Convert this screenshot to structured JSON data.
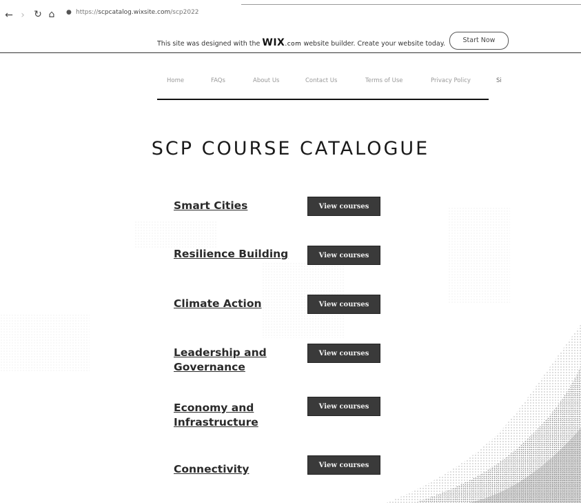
{
  "browser": {
    "url_prefix": "https://",
    "url_host": "scpcatalog.wixsite.com",
    "url_path": "/scp2022"
  },
  "wix_banner": {
    "text_before": "This site was designed with the ",
    "logo": "WIX",
    "logo_suffix": ".com",
    "text_after": " website builder. Create your website today.",
    "button": "Start Now"
  },
  "nav": {
    "items": [
      "Home",
      "FAQs",
      "About Us",
      "Contact Us",
      "Terms of Use",
      "Privacy Policy",
      "Si"
    ]
  },
  "page": {
    "title": "SCP COURSE CATALOGUE"
  },
  "courses": [
    {
      "name": "Smart Cities",
      "button": "View courses"
    },
    {
      "name": "Resilience Building",
      "button": "View courses"
    },
    {
      "name": "Climate Action",
      "button": "View courses"
    },
    {
      "name": "Leadership and Governance",
      "button": "View courses"
    },
    {
      "name": "Economy and Infrastructure",
      "button": "View courses"
    },
    {
      "name": "Connectivity",
      "button": "View courses"
    }
  ]
}
